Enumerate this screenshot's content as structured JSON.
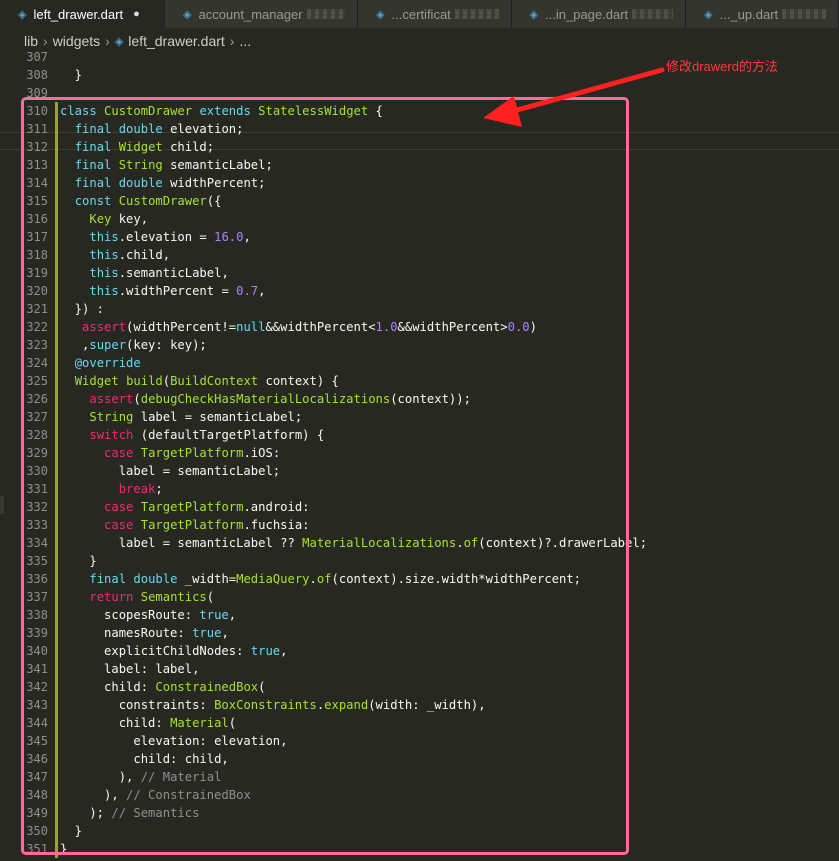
{
  "tabs": [
    {
      "label": "left_drawer.dart",
      "active": true,
      "modified": true
    },
    {
      "label": "account_manager",
      "active": false,
      "modified": false
    },
    {
      "label": "...certificat",
      "active": false,
      "modified": false
    },
    {
      "label": "...in_page.dart",
      "active": false,
      "modified": false
    },
    {
      "label": "..._up.dart",
      "active": false,
      "modified": false
    }
  ],
  "breadcrumb": {
    "parts": [
      "lib",
      "widgets"
    ],
    "file": "left_drawer.dart",
    "tail": "..."
  },
  "annotation": {
    "text": "修改drawerd的方法",
    "color": "#ff3a3a",
    "box_color": "#ff6b9a"
  },
  "colors": {
    "background": "#272822",
    "keyword": "#66d9ef",
    "type": "#a6e22e",
    "control": "#f92672",
    "number": "#ae81ff",
    "comment": "#8f908a"
  },
  "code_lines": [
    {
      "n": "307",
      "html": ""
    },
    {
      "n": "308",
      "html": "  }"
    },
    {
      "n": "309",
      "html": ""
    },
    {
      "n": "310",
      "html": "<span class='k'>class</span> <span class='t'>CustomDrawer</span> <span class='k'>extends</span> <span class='t'>StatelessWidget</span> {"
    },
    {
      "n": "311",
      "html": "  <span class='k'>final</span> <span class='k'>double</span> elevation;"
    },
    {
      "n": "312",
      "html": "  <span class='k'>final</span> <span class='t'>Widget</span> child;"
    },
    {
      "n": "313",
      "html": "  <span class='k'>final</span> <span class='t'>String</span> semanticLabel;"
    },
    {
      "n": "314",
      "html": "  <span class='k'>final</span> <span class='k'>double</span> widthPercent;"
    },
    {
      "n": "315",
      "html": "  <span class='k'>const</span> <span class='t'>CustomDrawer</span>({"
    },
    {
      "n": "316",
      "html": "    <span class='t'>Key</span> key,"
    },
    {
      "n": "317",
      "html": "    <span class='k'>this</span>.elevation = <span class='n'>16.0</span>,"
    },
    {
      "n": "318",
      "html": "    <span class='k'>this</span>.child,"
    },
    {
      "n": "319",
      "html": "    <span class='k'>this</span>.semanticLabel,"
    },
    {
      "n": "320",
      "html": "    <span class='k'>this</span>.widthPercent = <span class='n'>0.7</span>,"
    },
    {
      "n": "321",
      "html": "  }) :"
    },
    {
      "n": "322",
      "html": "   <span class='c'>assert</span>(widthPercent!=<span class='k'>null</span>&amp;&amp;widthPercent&lt;<span class='n'>1.0</span>&amp;&amp;widthPercent&gt;<span class='n'>0.0</span>)"
    },
    {
      "n": "323",
      "html": "   ,<span class='k'>super</span>(key: key);"
    },
    {
      "n": "324",
      "html": "  <span class='k'>@override</span>"
    },
    {
      "n": "325",
      "html": "  <span class='t'>Widget</span> <span class='t'>build</span>(<span class='t'>BuildContext</span> context) {"
    },
    {
      "n": "326",
      "html": "    <span class='c'>assert</span>(<span class='t'>debugCheckHasMaterialLocalizations</span>(context));"
    },
    {
      "n": "327",
      "html": "    <span class='t'>String</span> label = semanticLabel;"
    },
    {
      "n": "328",
      "html": "    <span class='c'>switch</span> (defaultTargetPlatform) {"
    },
    {
      "n": "329",
      "html": "      <span class='c'>case</span> <span class='t'>TargetPlatform</span>.iOS:"
    },
    {
      "n": "330",
      "html": "        label = semanticLabel;"
    },
    {
      "n": "331",
      "html": "        <span class='c'>break</span>;"
    },
    {
      "n": "332",
      "html": "      <span class='c'>case</span> <span class='t'>TargetPlatform</span>.android:"
    },
    {
      "n": "333",
      "html": "      <span class='c'>case</span> <span class='t'>TargetPlatform</span>.fuchsia:"
    },
    {
      "n": "334",
      "html": "        label = semanticLabel ?? <span class='t'>MaterialLocalizations</span>.<span class='t'>of</span>(context)?.drawerLabel;"
    },
    {
      "n": "335",
      "html": "    }"
    },
    {
      "n": "336",
      "html": "    <span class='k'>final</span> <span class='k'>double</span> _width=<span class='t'>MediaQuery</span>.<span class='t'>of</span>(context).size.width*widthPercent;"
    },
    {
      "n": "337",
      "html": "    <span class='c'>return</span> <span class='t'>Semantics</span>("
    },
    {
      "n": "338",
      "html": "      scopesRoute: <span class='k'>true</span>,"
    },
    {
      "n": "339",
      "html": "      namesRoute: <span class='k'>true</span>,"
    },
    {
      "n": "340",
      "html": "      explicitChildNodes: <span class='k'>true</span>,"
    },
    {
      "n": "341",
      "html": "      label: label,"
    },
    {
      "n": "342",
      "html": "      child: <span class='t'>ConstrainedBox</span>("
    },
    {
      "n": "343",
      "html": "        constraints: <span class='t'>BoxConstraints</span>.<span class='t'>expand</span>(width: _width),"
    },
    {
      "n": "344",
      "html": "        child: <span class='t'>Material</span>("
    },
    {
      "n": "345",
      "html": "          elevation: elevation,"
    },
    {
      "n": "346",
      "html": "          child: child,"
    },
    {
      "n": "347",
      "html": "        ), <span class='cm'>// Material</span>"
    },
    {
      "n": "348",
      "html": "      ), <span class='cm'>// ConstrainedBox</span>"
    },
    {
      "n": "349",
      "html": "    ); <span class='cm'>// Semantics</span>"
    },
    {
      "n": "350",
      "html": "  }"
    },
    {
      "n": "351",
      "html": "}"
    }
  ]
}
